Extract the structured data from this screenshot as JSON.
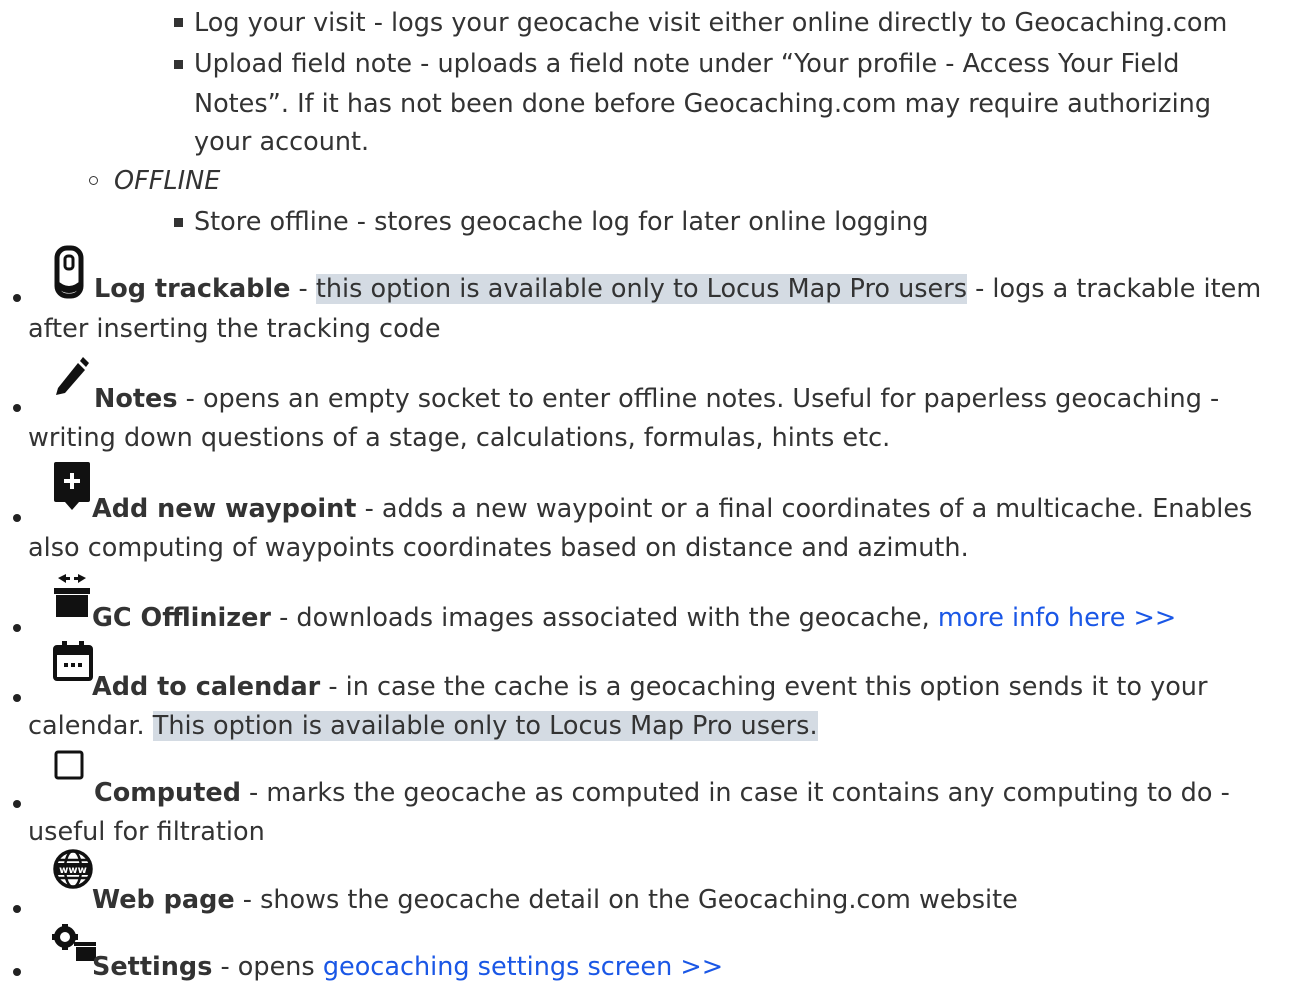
{
  "sub_items": [
    {
      "text": "Log your visit - logs your geocache visit either online directly to Geocaching.com"
    },
    {
      "lines": [
        "Upload field note - uploads a field note under “Your profile - Access Your Field",
        "Notes”. If it has not been done before Geocaching.com may require authorizing",
        "your account."
      ]
    },
    {
      "label": "OFFLINE"
    },
    {
      "text": "Store offline - stores geocache log for later online logging"
    }
  ],
  "items": [
    {
      "icon": "tracker-icon",
      "title": "Log trackable",
      "sep": " - ",
      "highlight": "this option is available only to Locus Map Pro users",
      "rest": " - logs a trackable item",
      "line2": "after inserting the tracking code"
    },
    {
      "icon": "pencil-icon",
      "title": "Notes",
      "rest": " - opens an empty socket to enter offline notes. Useful for paperless geocaching -",
      "line2": "writing down questions of a stage, calculations, formulas, hints etc."
    },
    {
      "icon": "add-waypoint-icon",
      "title": "Add new waypoint",
      "rest": " - adds a new waypoint or a final coordinates of a multicache. Enables",
      "line2": "also computing of waypoints coordinates based on distance and azimuth."
    },
    {
      "icon": "offlinizer-icon",
      "title": "GC Offlinizer",
      "rest": " - downloads images associated with the geocache, ",
      "link": "more info here >>"
    },
    {
      "icon": "calendar-icon",
      "title": "Add to calendar",
      "rest": " - in case the cache is a geocaching event this option sends it to your",
      "line2a": "calendar. ",
      "line2_highlight": "This option is available only to Locus Map Pro users."
    },
    {
      "icon": "checkbox-icon",
      "title": "Computed",
      "rest": " - marks the geocache as computed in case it contains any computing to do -",
      "line2": "useful for filtration"
    },
    {
      "icon": "globe-www-icon",
      "title": "Web page",
      "rest": " - shows the geocache detail on the Geocaching.com website"
    },
    {
      "icon": "settings-icon",
      "title": "Settings",
      "rest": " - opens ",
      "link": "geocaching settings screen >>"
    }
  ],
  "icon_text": {
    "www": "www"
  }
}
